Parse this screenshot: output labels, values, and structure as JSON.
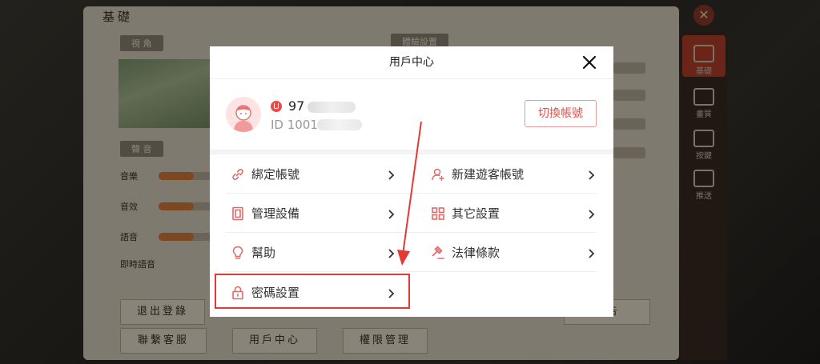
{
  "background": {
    "title": "基礎",
    "close_glyph": "✕",
    "sections": [
      "視 角",
      "聲 音",
      "體驗設置"
    ],
    "sound_rows": [
      "音樂",
      "音效",
      "語音",
      "即時語音"
    ],
    "buttons": [
      "退出登錄",
      "聯繫客服",
      "用戶中心",
      "權限管理",
      "公告"
    ],
    "side_tabs": [
      "基礎",
      "畫質",
      "按鍵",
      "推送"
    ]
  },
  "modal": {
    "title": "用戶中心",
    "close_icon": "close-icon",
    "user": {
      "name_prefix": "97",
      "id_prefix": "ID 1001",
      "switch_label": "切換帳號"
    },
    "menu": [
      {
        "label": "綁定帳號",
        "icon": "link-icon"
      },
      {
        "label": "新建遊客帳號",
        "icon": "add-user-icon"
      },
      {
        "label": "管理設備",
        "icon": "device-icon"
      },
      {
        "label": "其它設置",
        "icon": "grid-icon"
      },
      {
        "label": "幫助",
        "icon": "lightbulb-icon"
      },
      {
        "label": "法律條款",
        "icon": "gavel-icon"
      },
      {
        "label": "密碼設置",
        "icon": "lock-icon"
      }
    ]
  },
  "colors": {
    "accent": "#e53935",
    "icon": "#e06a6a",
    "switch_border": "#e29a9a"
  }
}
